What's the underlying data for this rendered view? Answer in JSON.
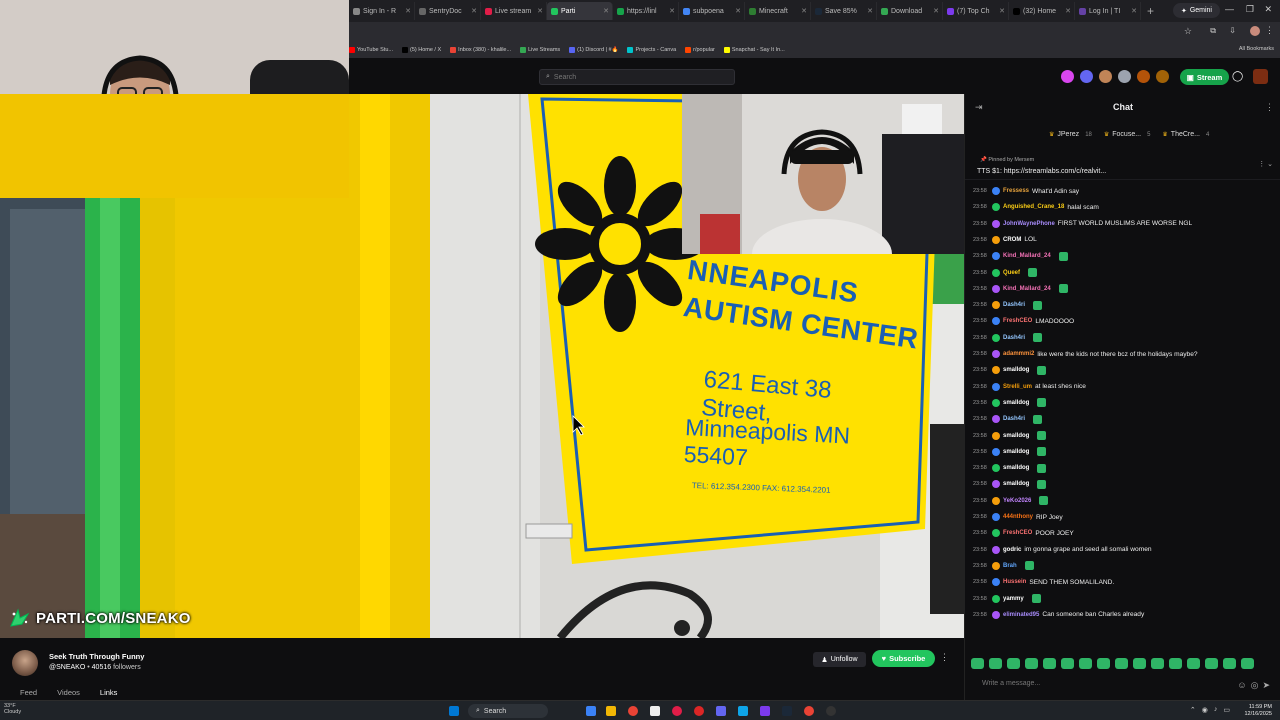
{
  "browser": {
    "tabs": [
      {
        "label": "Sign In - R",
        "color": "#888888"
      },
      {
        "label": "SentryDoc",
        "color": "#666666"
      },
      {
        "label": "Live stream",
        "color": "#e11d48"
      },
      {
        "label": "Parti",
        "color": "#22c55e",
        "active": true
      },
      {
        "label": "https://linl",
        "color": "#16a34a"
      },
      {
        "label": "subpoena",
        "color": "#4285f4"
      },
      {
        "label": "Minecraft",
        "color": "#2e7d32"
      },
      {
        "label": "Save 85%",
        "color": "#1b2838"
      },
      {
        "label": "Download",
        "color": "#34a853"
      },
      {
        "label": "(7) Top Ch",
        "color": "#7c3aed"
      },
      {
        "label": "(32) Home",
        "color": "#000000"
      },
      {
        "label": "Log In | TI",
        "color": "#6441a5"
      }
    ],
    "gemini_label": "Gemini",
    "bookmarks": [
      {
        "label": "YouTube Stu...",
        "color": "#ff0000"
      },
      {
        "label": "(5) Home / X",
        "color": "#000000"
      },
      {
        "label": "Inbox (380) - khalile...",
        "color": "#ea4335"
      },
      {
        "label": "Live Streams",
        "color": "#34a853"
      },
      {
        "label": "(1) Discord | #🔥",
        "color": "#5865f2"
      },
      {
        "label": "Projects - Canva",
        "color": "#00c4cc"
      },
      {
        "label": "r/popular",
        "color": "#ff4500"
      },
      {
        "label": "Snapchat - Say It In...",
        "color": "#fffc00"
      }
    ],
    "all_bookmarks": "All Bookmarks"
  },
  "site": {
    "search_placeholder": "Search",
    "stream_button": "Stream"
  },
  "video": {
    "sign_lines": [
      "NNEAPOLIS",
      "AUTISM CENTER",
      "621 East 38 Street,",
      "Minneapolis MN 55407",
      "TEL: 612.354.2300   FAX: 612.354.2201"
    ],
    "overlay_text": "PARTI.COM/SNEAKO"
  },
  "channel": {
    "title": "Seek Truth Through Funny",
    "handle": "@SNEAKO",
    "followers_count": "40516",
    "followers_label": "followers",
    "tabs": [
      "Feed",
      "Videos",
      "Links"
    ],
    "active_tab": "Links",
    "unfollow_label": "Unfollow",
    "subscribe_label": "Subscribe"
  },
  "chat": {
    "title": "Chat",
    "leaders": [
      {
        "name": "JPerez",
        "count": "18"
      },
      {
        "name": "Focuse...",
        "count": "5"
      },
      {
        "name": "TheCre...",
        "count": "4"
      }
    ],
    "pinned_by": "Pinned by",
    "pinned_user": "Mersem",
    "pinned_message": "TTS $1: https://streamlabs.com/c/realvit...",
    "messages": [
      {
        "time": "23:58",
        "user": "Fressess",
        "color": "#e6a23c",
        "text": "What'd Adin say",
        "emote": false
      },
      {
        "time": "23:58",
        "user": "Anguished_Crane_18",
        "color": "#facc15",
        "text": "halal scam",
        "emote": false
      },
      {
        "time": "23:58",
        "user": "JohnWaynePhone",
        "color": "#a78bfa",
        "text": "FIRST WORLD MUSLIMS ARE WORSE NGL",
        "emote": false
      },
      {
        "time": "23:58",
        "user": "CROM",
        "color": "#ffffff",
        "text": "LOL",
        "emote": false
      },
      {
        "time": "23:58",
        "user": "Kind_Mallard_24",
        "color": "#f472b6",
        "text": "",
        "emote": true
      },
      {
        "time": "23:58",
        "user": "Queef",
        "color": "#facc15",
        "text": "",
        "emote": true
      },
      {
        "time": "23:58",
        "user": "Kind_Mallard_24",
        "color": "#f472b6",
        "text": "",
        "emote": true
      },
      {
        "time": "23:58",
        "user": "Dash4ri",
        "color": "#93c5fd",
        "text": "",
        "emote": true
      },
      {
        "time": "23:58",
        "user": "FreshCEO",
        "color": "#f87171",
        "text": "LMADOOOO",
        "emote": false
      },
      {
        "time": "23:58",
        "user": "Dash4ri",
        "color": "#93c5fd",
        "text": "",
        "emote": true
      },
      {
        "time": "23:58",
        "user": "adammmi2",
        "color": "#fb923c",
        "text": "like were the kids not there bcz of the holidays maybe?",
        "emote": false
      },
      {
        "time": "23:58",
        "user": "smalldog",
        "color": "#ffffff",
        "text": "",
        "emote": true
      },
      {
        "time": "23:58",
        "user": "Strelli_um",
        "color": "#f59e0b",
        "text": "at least shes nice",
        "emote": false
      },
      {
        "time": "23:58",
        "user": "smalldog",
        "color": "#ffffff",
        "text": "",
        "emote": true
      },
      {
        "time": "23:58",
        "user": "Dash4ri",
        "color": "#93c5fd",
        "text": "",
        "emote": true
      },
      {
        "time": "23:58",
        "user": "smalldog",
        "color": "#ffffff",
        "text": "",
        "emote": true
      },
      {
        "time": "23:58",
        "user": "smalldog",
        "color": "#ffffff",
        "text": "",
        "emote": true
      },
      {
        "time": "23:58",
        "user": "smalldog",
        "color": "#ffffff",
        "text": "",
        "emote": true
      },
      {
        "time": "23:58",
        "user": "smalldog",
        "color": "#ffffff",
        "text": "",
        "emote": true
      },
      {
        "time": "23:58",
        "user": "YeKo2026",
        "color": "#c084fc",
        "text": "",
        "emote": true
      },
      {
        "time": "23:58",
        "user": "444nthony",
        "color": "#f97316",
        "text": "RIP Joey",
        "emote": false
      },
      {
        "time": "23:58",
        "user": "FreshCEO",
        "color": "#f87171",
        "text": "POOR JOEY",
        "emote": false
      },
      {
        "time": "23:58",
        "user": "godric",
        "color": "#ffffff",
        "text": "im gonna grape and seed all somali women",
        "emote": false
      },
      {
        "time": "23:58",
        "user": "Brah",
        "color": "#60a5fa",
        "text": "",
        "emote": true
      },
      {
        "time": "23:58",
        "user": "Hussein",
        "color": "#f87171",
        "text": "SEND THEM SOMALILAND.",
        "emote": false
      },
      {
        "time": "23:58",
        "user": "yammy",
        "color": "#ffffff",
        "text": "",
        "emote": true
      },
      {
        "time": "23:58",
        "user": "eliminated95",
        "color": "#a78bfa",
        "text": "Can someone ban Charles already",
        "emote": false
      }
    ],
    "input_placeholder": "Write a message..."
  },
  "taskbar": {
    "weather_temp": "33°F",
    "weather_desc": "Cloudy",
    "search_label": "Search",
    "time": "11:59 PM",
    "date": "12/16/2025"
  }
}
